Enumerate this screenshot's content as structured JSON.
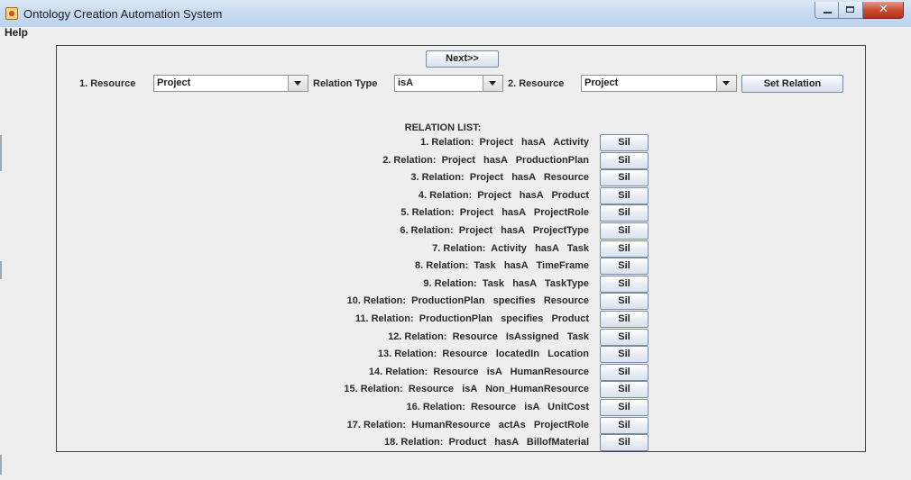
{
  "window": {
    "title": "Ontology Creation Automation System",
    "close_glyph": "✕"
  },
  "menu": {
    "help": "Help"
  },
  "toolbar": {
    "next_label": "Next>>",
    "resource1_label": "1. Resource",
    "resource1_value": "Project",
    "relation_type_label": "Relation Type",
    "relation_type_value": "isA",
    "resource2_label": "2. Resource",
    "resource2_value": "Project",
    "set_relation_label": "Set Relation"
  },
  "relation_list": {
    "title": "RELATION LIST:",
    "delete_label": "Sil",
    "items": [
      "1. Relation:  Project   hasA   Activity",
      "2. Relation:  Project   hasA   ProductionPlan",
      "3. Relation:  Project   hasA   Resource",
      "4. Relation:  Project   hasA   Product",
      "5. Relation:  Project   hasA   ProjectRole",
      "6. Relation:  Project   hasA   ProjectType",
      "7. Relation:  Activity   hasA   Task",
      "8. Relation:  Task   hasA   TimeFrame",
      "9. Relation:  Task   hasA   TaskType",
      "10. Relation:  ProductionPlan   specifies   Resource",
      "11. Relation:  ProductionPlan   specifies   Product",
      "12. Relation:  Resource   IsAssigned   Task",
      "13. Relation:  Resource   locatedIn   Location",
      "14. Relation:  Resource   isA   HumanResource",
      "15. Relation:  Resource   isA   Non_HumanResource",
      "16. Relation:  Resource   isA   UnitCost",
      "17. Relation:  HumanResource   actAs   ProjectRole",
      "18. Relation:  Product   hasA   BillofMaterial"
    ]
  }
}
